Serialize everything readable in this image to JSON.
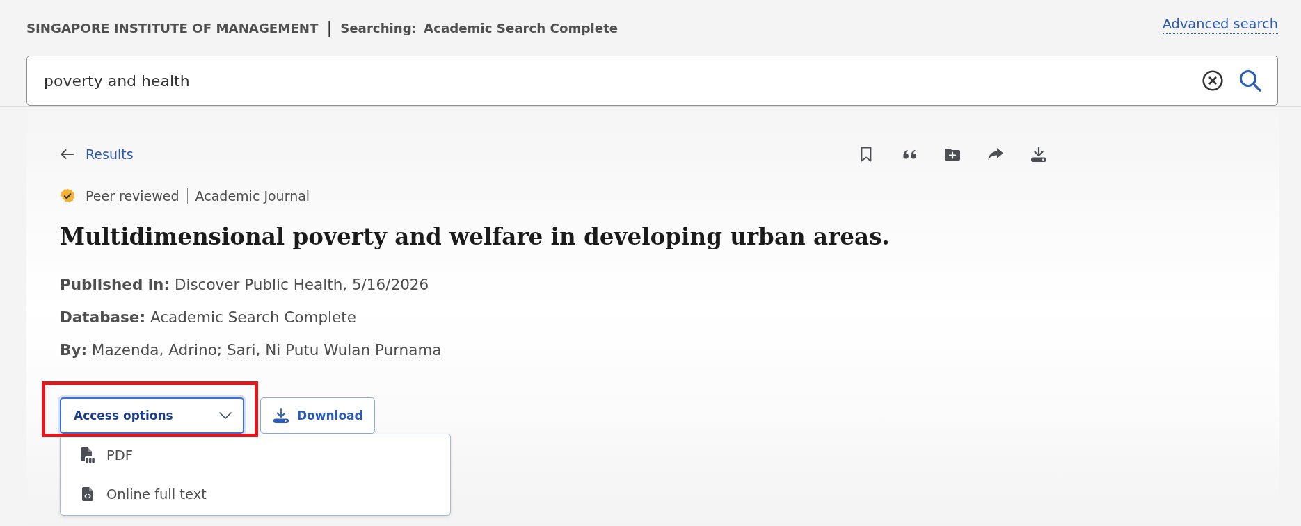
{
  "header": {
    "institution": "SINGAPORE INSTITUTE OF MANAGEMENT",
    "separator": "|",
    "searching_label": "Searching:",
    "database": "Academic Search Complete",
    "advanced_search_link": "Advanced search"
  },
  "search": {
    "value": "poverty and health"
  },
  "back_link": {
    "label": "Results"
  },
  "record": {
    "peer_review_label": "Peer reviewed",
    "source_type": "Academic Journal",
    "title": "Multidimensional poverty and welfare in developing urban areas.",
    "fields": [
      {
        "kind": "text",
        "label": "Published in:",
        "value": "Discover Public Health, 5/16/2026"
      },
      {
        "kind": "text",
        "label": "Database:",
        "value": "Academic Search Complete"
      },
      {
        "kind": "authors",
        "label": "By:",
        "authors": [
          "Mazenda, Adrino",
          "Sari, Ni Putu Wulan Purnama"
        ],
        "separator": ";"
      }
    ]
  },
  "access_options": {
    "label": "Access options",
    "expanded": true,
    "highlighted": true,
    "items": [
      {
        "kind": "pdf",
        "label": "PDF"
      },
      {
        "kind": "html",
        "label": "Online full text"
      }
    ]
  },
  "download_button": {
    "label": "Download"
  }
}
